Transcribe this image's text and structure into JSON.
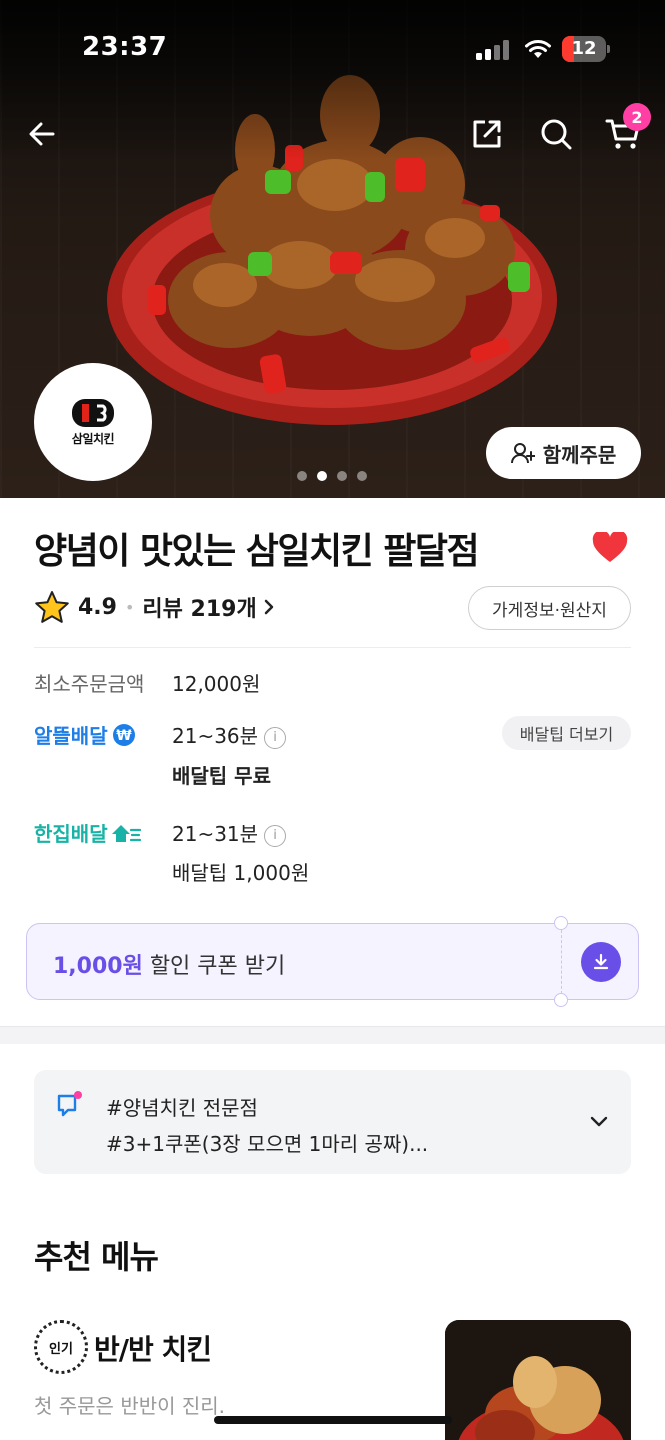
{
  "status_bar": {
    "time": "23:37",
    "battery": "12"
  },
  "header": {
    "cart_count": "2",
    "group_order_label": "함께주문",
    "logo_text": "삼일치킨"
  },
  "carousel": {
    "count": 4,
    "active_index": 1
  },
  "store": {
    "name": "양념이 맛있는 삼일치킨 팔달점",
    "rating": "4.9",
    "review_label": "리뷰 219개",
    "info_chip": "가게정보·원산지"
  },
  "order_info": {
    "min_order_label": "최소주문금액",
    "min_order_value": "12,000원",
    "alttul": {
      "brand": "알뜰배달",
      "time": "21~36분",
      "tip": "배달팁 무료",
      "more": "배달팁 더보기"
    },
    "hanjip": {
      "brand": "한집배달",
      "time": "21~31분",
      "tip": "배달팁 1,000원"
    }
  },
  "coupon": {
    "amount": "1,000원",
    "text": " 할인 쿠폰 받기"
  },
  "notice": {
    "line1": "#양념치킨 전문점",
    "line2": "#3+1쿠폰(3장 모으면 1마리 공짜)..."
  },
  "recommended": {
    "title": "추천 메뉴",
    "items": [
      {
        "badge": "인기",
        "name": "반/반 치킨",
        "desc": "첫 주문은 반반이 진리."
      }
    ]
  },
  "colors": {
    "accent_purple": "#6a4ee8",
    "heart_red": "#f0353d",
    "badge_pink": "#ff3fa4",
    "alttul_blue": "#1e7ee8",
    "hanjip_teal": "#18b3a6"
  }
}
